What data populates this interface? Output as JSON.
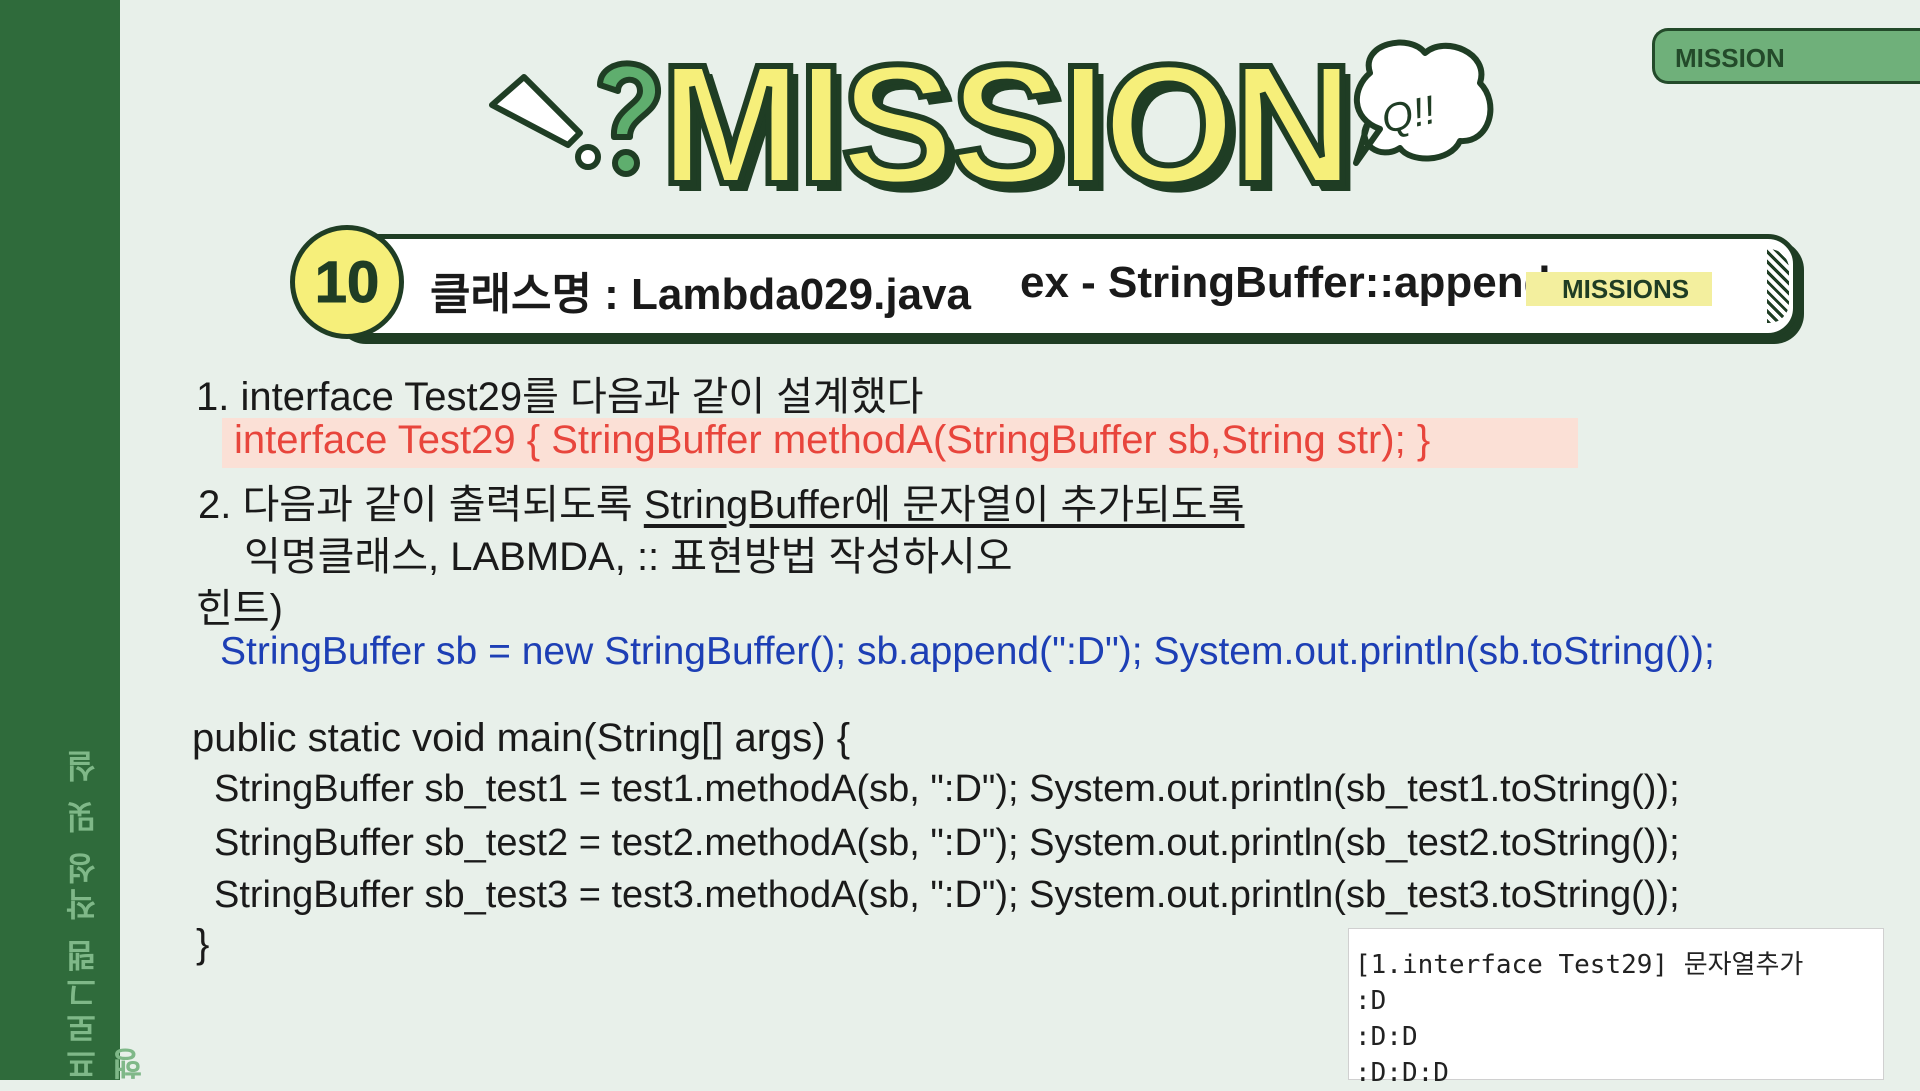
{
  "sidebar": {
    "label": "프로그램 작성 및 실행"
  },
  "side_tab": {
    "label": "MISSION"
  },
  "title": {
    "text": "MISSION",
    "bubble": "Q!!"
  },
  "mission_bar": {
    "number": "10",
    "class_label": "클래스명 : Lambda029.java",
    "example_label": "ex - StringBuffer::append",
    "tag": "MISSIONS"
  },
  "content": {
    "line1": "1. interface Test29를 다음과 같이 설계했다",
    "line2": "interface Test29 { StringBuffer methodA(StringBuffer sb,String str); }",
    "line3_prefix": "2. 다음과 같이 출력되도록 ",
    "line3_underlined": "StringBuffer에 문자열이 추가되도록",
    "line4": "익명클래스, LABMDA, :: 표현방법 작성하시오",
    "hint_label": "힌트)",
    "hint_code": "StringBuffer sb = new StringBuffer();  sb.append(\":D\");  System.out.println(sb.toString());",
    "main_open": "public static void main(String[] args) {",
    "main_line1": "StringBuffer sb_test1 = test1.methodA(sb, \":D\");   System.out.println(sb_test1.toString());",
    "main_line2": "StringBuffer sb_test2 = test2.methodA(sb, \":D\");  System.out.println(sb_test2.toString());",
    "main_line3": "StringBuffer sb_test3 = test3.methodA(sb, \":D\");  System.out.println(sb_test3.toString());",
    "main_close": "}"
  },
  "console": {
    "lines": [
      "[1.interface Test29] 문자열추가",
      ":D",
      ":D:D",
      ":D:D:D"
    ]
  },
  "colors": {
    "sidebar": "#2f6b3b",
    "accent_yellow": "#f6ef7a",
    "outline": "#1f3d24",
    "hint_blue": "#1d3fb5",
    "code_red": "#e8453c"
  }
}
